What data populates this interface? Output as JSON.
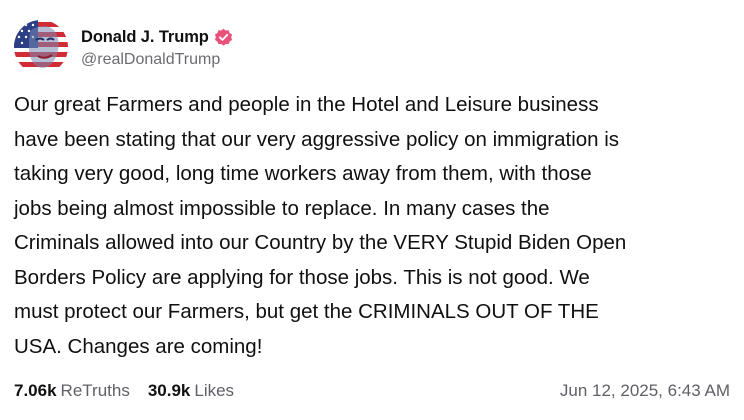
{
  "author": {
    "display_name": "Donald J. Trump",
    "handle": "@realDonaldTrump",
    "avatar_icon": "flag-portrait-avatar",
    "verified_icon": "verified-badge-icon",
    "verified_color": "#e7517a"
  },
  "post": {
    "lines": [
      "Our great Farmers and people in the Hotel and Leisure business",
      "have been stating that our very aggressive policy on immigration is",
      "taking very good, long time workers away from them, with those",
      "jobs being almost impossible to replace. In many cases the",
      "Criminals allowed into our Country by the VERY Stupid Biden Open",
      "Borders Policy are applying for those jobs. This is not good. We",
      "must protect our Farmers, but get the CRIMINALS OUT OF THE",
      "USA. Changes are coming!"
    ]
  },
  "stats": {
    "retruths_count": "7.06k",
    "retruths_label": "ReTruths",
    "likes_count": "30.9k",
    "likes_label": "Likes"
  },
  "timestamp": "Jun 12, 2025, 6:43 AM"
}
